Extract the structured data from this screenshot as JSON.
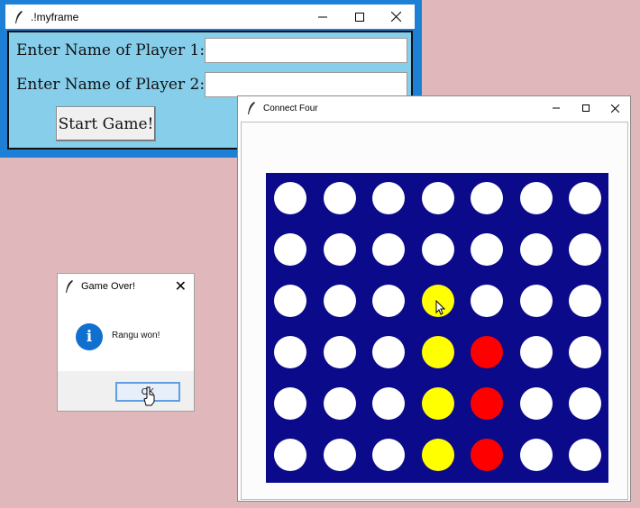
{
  "player_window": {
    "title": ".!myframe",
    "label_player1": "Enter Name of Player 1:",
    "label_player2": "Enter Name of Player 2:",
    "player1_value": "",
    "player2_value": "",
    "start_label": "Start Game!"
  },
  "game_window": {
    "title": "Connect Four",
    "board": {
      "columns": 7,
      "rows": 6,
      "cells": [
        [
          "white",
          "white",
          "white",
          "white",
          "white",
          "white",
          "white"
        ],
        [
          "white",
          "white",
          "white",
          "white",
          "white",
          "white",
          "white"
        ],
        [
          "white",
          "white",
          "white",
          "yellow",
          "white",
          "white",
          "white"
        ],
        [
          "white",
          "white",
          "white",
          "yellow",
          "red",
          "white",
          "white"
        ],
        [
          "white",
          "white",
          "white",
          "yellow",
          "red",
          "white",
          "white"
        ],
        [
          "white",
          "white",
          "white",
          "yellow",
          "red",
          "white",
          "white"
        ]
      ]
    },
    "colors": {
      "board": "#0a0a8a",
      "white": "#ffffff",
      "yellow": "#ffff00",
      "red": "#ff0000"
    }
  },
  "dialog": {
    "title": "Game Over!",
    "message": "Rangu won!",
    "ok_label": "OK",
    "icon": "info-icon",
    "close_icon": "✕"
  },
  "titlebar_icons": {
    "minimize": "minimize-icon",
    "maximize": "maximize-icon",
    "close": "close-icon"
  }
}
